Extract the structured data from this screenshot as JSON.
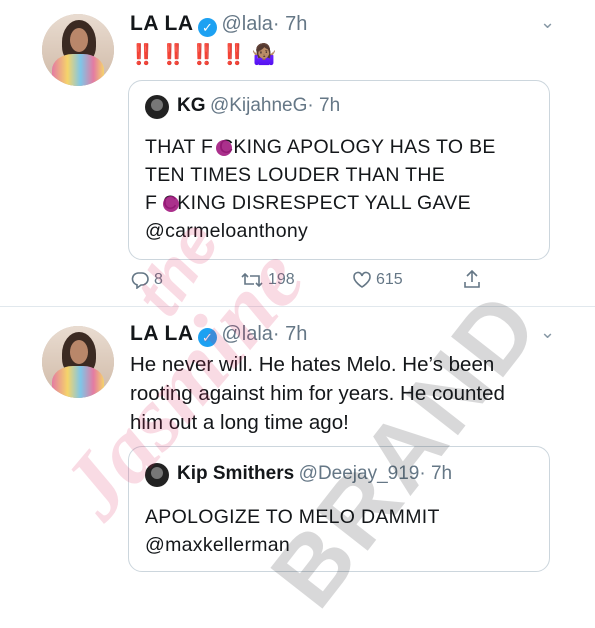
{
  "tweet1": {
    "display_name": "LA LA",
    "handle": "@lala",
    "time": "· 7h",
    "text": "‼️ ‼️ ‼️ ‼️ 🤷🏽‍♀️",
    "quote": {
      "name": "KG",
      "handle": "@KijahneG",
      "time": "· 7h",
      "line1": "THAT F  CKING APOLOGY HAS TO BE",
      "line2": "TEN TIMES LOUDER THAN THE",
      "line3": "F  CKING DISRESPECT YALL GAVE",
      "line4": "@carmeloanthony"
    },
    "actions": {
      "replies": "8",
      "retweets": "198",
      "likes": "615"
    }
  },
  "tweet2": {
    "display_name": "LA LA",
    "handle": "@lala",
    "time": "· 7h",
    "line1": "He never will. He hates Melo. He’s been",
    "line2": "rooting against him for years. He counted",
    "line3": "him out a long time ago!",
    "quote": {
      "name": "Kip Smithers",
      "handle": "@Deejay_919",
      "time": "· 7h",
      "line1": "APOLOGIZE TO MELO DAMMIT",
      "line2": "@maxkellerman"
    }
  },
  "watermark": {
    "top": "the",
    "middle": "Jasmine",
    "bottom": "BRAND"
  },
  "colors": {
    "accent": "#1da1f2",
    "text": "#14171a",
    "muted": "#657786",
    "border": "#ccd6dd",
    "watermark_pink": "#e0245e"
  }
}
